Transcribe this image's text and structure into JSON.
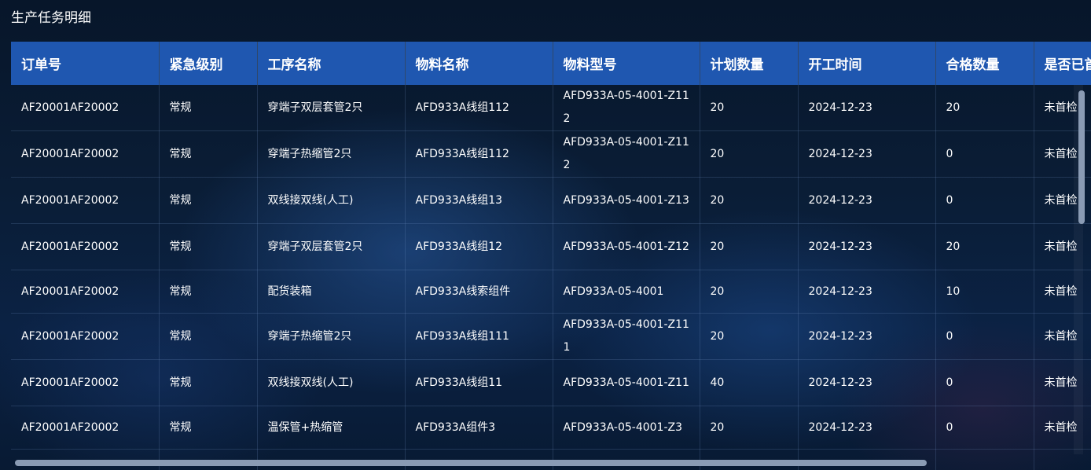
{
  "panel": {
    "title": "生产任务明细"
  },
  "table": {
    "columns": [
      "订单号",
      "紧急级别",
      "工序名称",
      "物料名称",
      "物料型号",
      "计划数量",
      "开工时间",
      "合格数量",
      "是否已首"
    ],
    "rows": [
      [
        "AF20001AF20002",
        "常规",
        "穿端子双层套管2只",
        "AFD933A线组112",
        "AFD933A-05-4001-Z112",
        "20",
        "2024-12-23",
        "20",
        "未首检"
      ],
      [
        "AF20001AF20002",
        "常规",
        "穿端子热缩管2只",
        "AFD933A线组112",
        "AFD933A-05-4001-Z112",
        "20",
        "2024-12-23",
        "0",
        "未首检"
      ],
      [
        "AF20001AF20002",
        "常规",
        "双线接双线(人工)",
        "AFD933A线组13",
        "AFD933A-05-4001-Z13",
        "20",
        "2024-12-23",
        "0",
        "未首检"
      ],
      [
        "AF20001AF20002",
        "常规",
        "穿端子双层套管2只",
        "AFD933A线组12",
        "AFD933A-05-4001-Z12",
        "20",
        "2024-12-23",
        "20",
        "未首检"
      ],
      [
        "AF20001AF20002",
        "常规",
        "配货装箱",
        "AFD933A线索组件",
        "AFD933A-05-4001",
        "20",
        "2024-12-23",
        "10",
        "未首检"
      ],
      [
        "AF20001AF20002",
        "常规",
        "穿端子热缩管2只",
        "AFD933A线组111",
        "AFD933A-05-4001-Z111",
        "20",
        "2024-12-23",
        "0",
        "未首检"
      ],
      [
        "AF20001AF20002",
        "常规",
        "双线接双线(人工)",
        "AFD933A线组11",
        "AFD933A-05-4001-Z11",
        "40",
        "2024-12-23",
        "0",
        "未首检"
      ],
      [
        "AF20001AF20002",
        "常规",
        "温保管+热缩管",
        "AFD933A组件3",
        "AFD933A-05-4001-Z3",
        "20",
        "2024-12-23",
        "0",
        "未首检"
      ],
      [
        "",
        "",
        "",
        "",
        "",
        "",
        "",
        "",
        ""
      ]
    ]
  }
}
